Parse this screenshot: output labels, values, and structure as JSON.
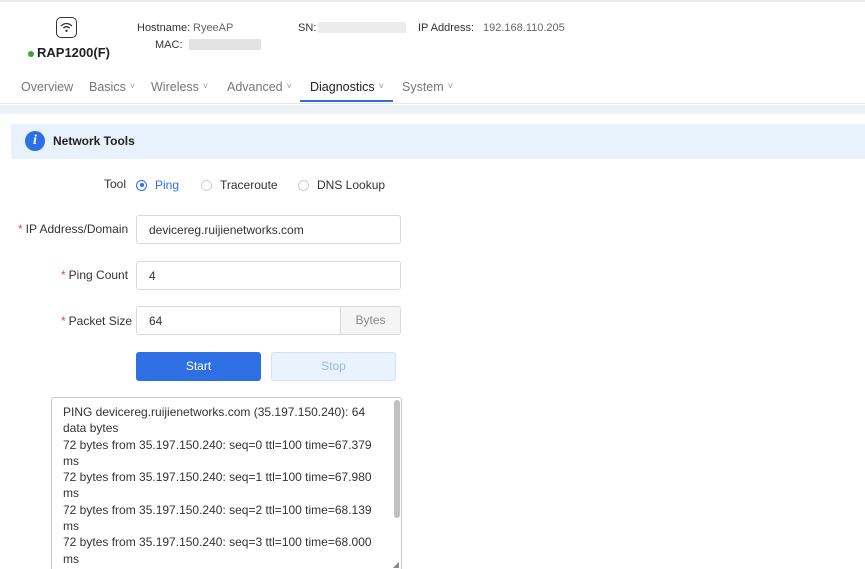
{
  "device": {
    "model": "RAP1200(F)",
    "icon": "wifi-icon",
    "status_color": "#3da33b"
  },
  "info": {
    "hostname_label": "Hostname:",
    "hostname_value": "RyeeAP",
    "mac_label": "MAC:",
    "sn_label": "SN:",
    "ip_label": "IP Address:",
    "ip_value": "192.168.110.205"
  },
  "nav": {
    "items": [
      {
        "label": "Overview",
        "has_menu": false
      },
      {
        "label": "Basics",
        "has_menu": true
      },
      {
        "label": "Wireless",
        "has_menu": true
      },
      {
        "label": "Advanced",
        "has_menu": true
      },
      {
        "label": "Diagnostics",
        "has_menu": true,
        "active": true
      },
      {
        "label": "System",
        "has_menu": true
      }
    ],
    "chevron": "˅"
  },
  "section": {
    "icon_glyph": "i",
    "title": "Network Tools"
  },
  "form": {
    "tool_label": "Tool",
    "tools": [
      {
        "label": "Ping",
        "checked": true
      },
      {
        "label": "Traceroute",
        "checked": false
      },
      {
        "label": "DNS Lookup",
        "checked": false
      }
    ],
    "ip_label": "IP Address/Domain",
    "ip_value": "devicereg.ruijienetworks.com",
    "count_label": "Ping Count",
    "count_value": "4",
    "size_label": "Packet Size",
    "size_value": "64",
    "size_unit": "Bytes",
    "required_mark": "*"
  },
  "actions": {
    "start_label": "Start",
    "stop_label": "Stop"
  },
  "output": {
    "text": "PING devicereg.ruijienetworks.com (35.197.150.240): 64 data bytes\n72 bytes from 35.197.150.240: seq=0 ttl=100 time=67.379 ms\n72 bytes from 35.197.150.240: seq=1 ttl=100 time=67.980 ms\n72 bytes from 35.197.150.240: seq=2 ttl=100 time=68.139 ms\n72 bytes from 35.197.150.240: seq=3 ttl=100 time=68.000 ms"
  },
  "colors": {
    "accent": "#2f6fe4",
    "required": "#e64545",
    "section_bg": "#e8f2fc"
  }
}
